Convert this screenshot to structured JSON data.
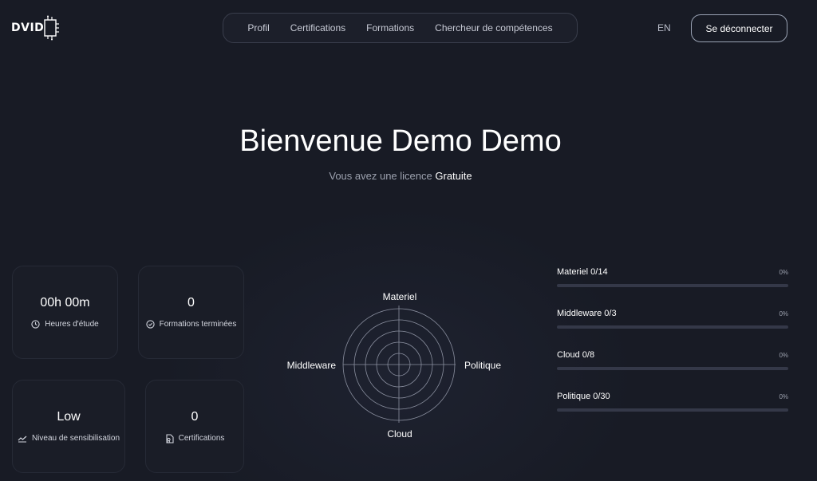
{
  "header": {
    "logo_text": "DVID",
    "nav": [
      {
        "label": "Profil"
      },
      {
        "label": "Certifications"
      },
      {
        "label": "Formations"
      },
      {
        "label": "Chercheur de compétences"
      }
    ],
    "language": "EN",
    "logout_label": "Se déconnecter"
  },
  "hero": {
    "title": "Bienvenue Demo Demo",
    "subtitle_prefix": "Vous avez une licence",
    "license_type": "Gratuite"
  },
  "stats": {
    "study_hours": {
      "value": "00h 00m",
      "label": "Heures d'étude",
      "icon": "clock-icon"
    },
    "formations_done": {
      "value": "0",
      "label": "Formations terminées",
      "icon": "check-circle-icon"
    },
    "awareness": {
      "value": "Low",
      "label": "Niveau de sensibilisation",
      "icon": "trend-line-icon"
    },
    "certifications": {
      "value": "0",
      "label": "Certifications",
      "icon": "certificate-icon"
    }
  },
  "radar": {
    "axes": {
      "top": "Materiel",
      "right": "Politique",
      "bottom": "Cloud",
      "left": "Middleware"
    }
  },
  "progress": [
    {
      "name": "Materiel 0/14",
      "percent_label": "0%",
      "fraction": 0
    },
    {
      "name": "Middleware 0/3",
      "percent_label": "0%",
      "fraction": 0
    },
    {
      "name": "Cloud 0/8",
      "percent_label": "0%",
      "fraction": 0
    },
    {
      "name": "Politique 0/30",
      "percent_label": "0%",
      "fraction": 0
    }
  ],
  "colors": {
    "background": "#181b25",
    "bar_track": "#343848",
    "bar_fill": "#8fa3c8"
  }
}
